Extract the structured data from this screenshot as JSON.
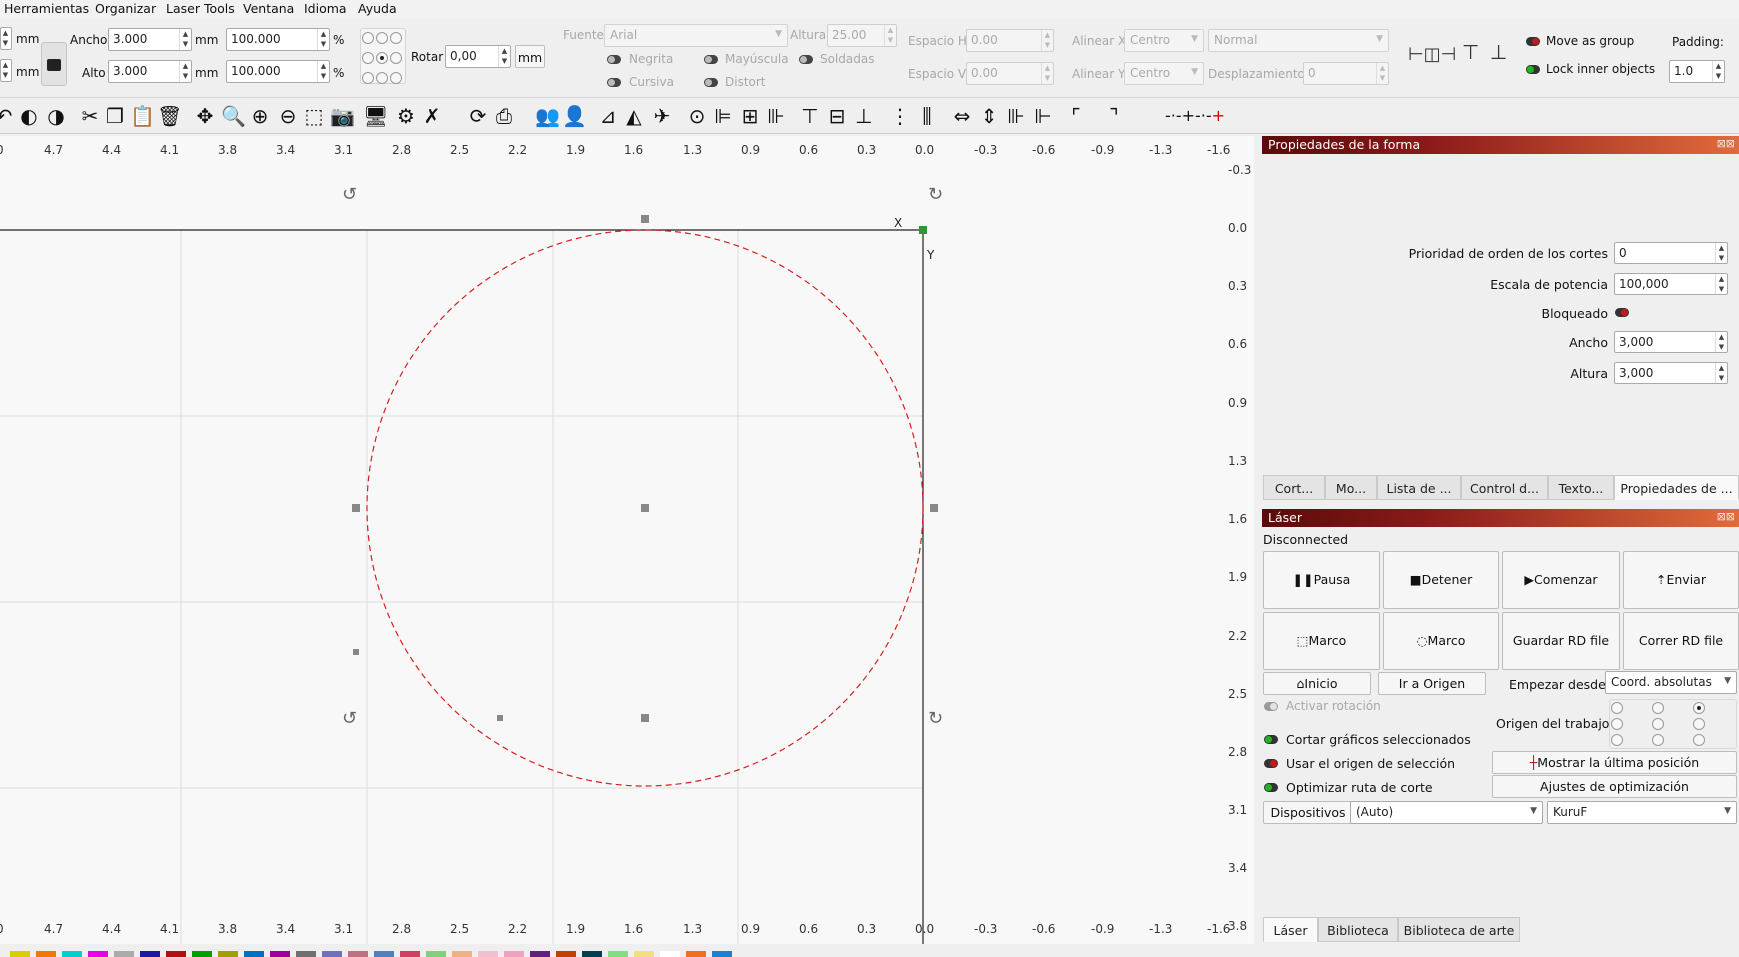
{
  "menu": [
    "Herramientas",
    "Organizar",
    "Laser Tools",
    "Ventana",
    "Idioma",
    "Ayuda"
  ],
  "size_toolbar": {
    "unit1": "mm",
    "unit2": "mm",
    "ancho_label": "Ancho",
    "ancho_value": "3.000",
    "ancho_unit": "mm",
    "ancho_pct": "100.000",
    "pct1": "%",
    "alto_label": "Alto",
    "alto_value": "3.000",
    "alto_unit": "mm",
    "alto_pct": "100.000",
    "pct2": "%",
    "rotar_label": "Rotar",
    "rotar_value": "0,00",
    "rotar_unit": "mm"
  },
  "text_toolbar": {
    "fuente_label": "Fuente",
    "fuente_value": "Arial",
    "altura_label": "Altura",
    "altura_value": "25.00",
    "espacio_h_label": "Espacio H",
    "espacio_h_value": "0.00",
    "espacio_v_label": "Espacio V",
    "espacio_v_value": "0.00",
    "alinear_x_label": "Alinear X",
    "alinear_x_value": "Centro",
    "alinear_y_label": "Alinear Y",
    "alinear_y_value": "Centro",
    "normal_value": "Normal",
    "desplazamiento_label": "Desplazamiento",
    "desplazamiento_value": "0",
    "negrita": "Negrita",
    "mayuscula": "Mayúscula",
    "soldadas": "Soldadas",
    "cursiva": "Cursiva",
    "distort": "Distort"
  },
  "group_toolbar": {
    "move_as_group": "Move as group",
    "lock_inner": "Lock inner objects",
    "padding_label": "Padding:",
    "padding_value": "1.0"
  },
  "ruler": {
    "x_ticks": [
      "0",
      "4.7",
      "4.4",
      "4.1",
      "3.8",
      "3.4",
      "3.1",
      "2.8",
      "2.5",
      "2.2",
      "1.9",
      "1.6",
      "1.3",
      "0.9",
      "0.6",
      "0.3",
      "0.0",
      "-0.3",
      "-0.6",
      "-0.9",
      "-1.3",
      "-1.6"
    ],
    "x_ticks_bottom": [
      "0",
      "4.7",
      "4.4",
      "4.1",
      "3.8",
      "3.4",
      "3.1",
      "2.8",
      "2.5",
      "2.2",
      "1.9",
      "1.6",
      "1.3",
      "0.9",
      "0.6",
      "0.3",
      "0.0",
      "-0.3",
      "-0.6",
      "-0.9",
      "-1.3",
      "-1.6"
    ],
    "y_ticks": [
      "-0.3",
      "0.0",
      "0.3",
      "0.6",
      "0.9",
      "1.3",
      "1.6",
      "1.9",
      "2.2",
      "2.5",
      "2.8",
      "3.1",
      "3.4",
      "3.8"
    ]
  },
  "canvas": {
    "x_label": "X",
    "y_label": "Y",
    "circle_color": "#d42020"
  },
  "shape_props": {
    "title": "Propiedades de la forma",
    "prioridad_label": "Prioridad de orden de los cortes",
    "prioridad_value": "0",
    "escala_label": "Escala de potencia",
    "escala_value": "100,000",
    "bloqueado_label": "Bloqueado",
    "ancho_label": "Ancho",
    "ancho_value": "3,000",
    "altura_label": "Altura",
    "altura_value": "3,000",
    "tabs": [
      "Cort...",
      "Mo...",
      "Lista de ...",
      "Control d...",
      "Texto...",
      "Propiedades de ..."
    ]
  },
  "laser": {
    "title": "Láser",
    "status": "Disconnected",
    "pausa": "Pausa",
    "detener": "Detener",
    "comenzar": "Comenzar",
    "enviar": "Enviar",
    "marco1": "Marco",
    "marco2": "Marco",
    "guardar": "Guardar RD file",
    "correr": "Correr RD file",
    "inicio": "Inicio",
    "ir_origen": "Ir a Origen",
    "empezar_label": "Empezar desde:",
    "empezar_value": "Coord. absolutas",
    "activar_rotacion": "Activar rotación",
    "origen_trabajo": "Origen del trabajo",
    "cortar_graficos": "Cortar gráficos seleccionados",
    "usar_origen": "Usar el origen de selección",
    "mostrar_ultima": "Mostrar la última posición",
    "optimizar": "Optimizar ruta de corte",
    "ajustes": "Ajustes de optimización",
    "dispositivos": "Dispositivos",
    "auto_value": "(Auto)",
    "device_value": "KuruF"
  },
  "bottom_tabs": [
    "Láser",
    "Biblioteca",
    "Biblioteca de arte"
  ],
  "palette": [
    "#d7d000",
    "#f07a00",
    "#00d0d0",
    "#e800e8",
    "#aaaaaa",
    "#1a1aa0",
    "#b01010",
    "#00a000",
    "#a0a000",
    "#0070c0",
    "#a000a0",
    "#707070",
    "#7070c0",
    "#c07080",
    "#5080c0",
    "#d04060",
    "#80d080",
    "#f0b080",
    "#f0c0d0",
    "#f0a0c0",
    "#602080",
    "#c04000",
    "#004050",
    "#80e080",
    "#f0e080",
    "#ffffff",
    "#f07020",
    "#2080d0"
  ]
}
